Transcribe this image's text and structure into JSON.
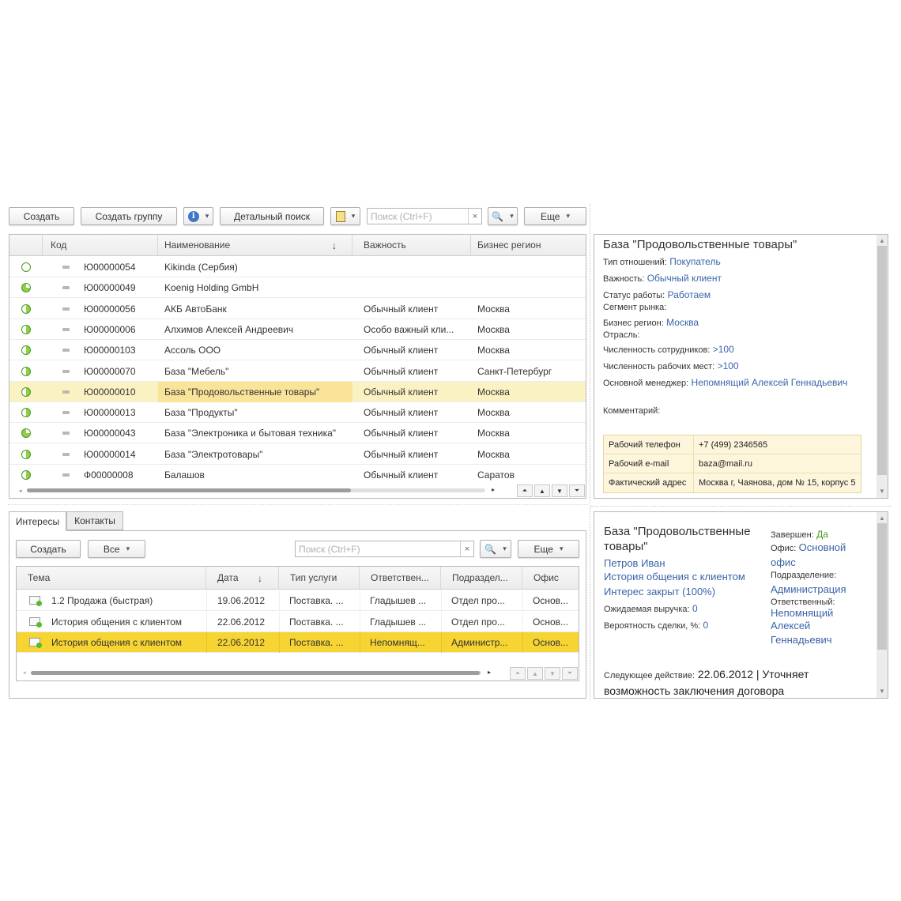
{
  "toolbar": {
    "create": "Создать",
    "create_group": "Создать группу",
    "detail_search": "Детальный поиск",
    "search_placeholder": "Поиск (Ctrl+F)",
    "more": "Еще"
  },
  "clients": {
    "columns": [
      "Код",
      "Наименование",
      "Важность",
      "Бизнес регион"
    ],
    "rows": [
      {
        "code": "Ю00000054",
        "name": "Kikinda (Сербия)",
        "importance": "",
        "region": "",
        "status": "empty"
      },
      {
        "code": "Ю00000049",
        "name": "Koenig Holding GmbH",
        "importance": "",
        "region": "",
        "status": "quarter"
      },
      {
        "code": "Ю00000056",
        "name": "АКБ АвтоБанк",
        "importance": "Обычный клиент",
        "region": "Москва",
        "status": "half"
      },
      {
        "code": "Ю00000006",
        "name": "Алхимов Алексей Андреевич",
        "importance": "Особо важный кли...",
        "region": "Москва",
        "status": "half"
      },
      {
        "code": "Ю00000103",
        "name": "Ассоль ООО",
        "importance": "Обычный клиент",
        "region": "Москва",
        "status": "half"
      },
      {
        "code": "Ю00000070",
        "name": "База \"Мебель\"",
        "importance": "Обычный клиент",
        "region": "Санкт-Петербург",
        "status": "half"
      },
      {
        "code": "Ю00000010",
        "name": "База \"Продовольственные товары\"",
        "importance": "Обычный клиент",
        "region": "Москва",
        "status": "half"
      },
      {
        "code": "Ю00000013",
        "name": "База \"Продукты\"",
        "importance": "Обычный клиент",
        "region": "Москва",
        "status": "half"
      },
      {
        "code": "Ю00000043",
        "name": "База \"Электроника и бытовая техника\"",
        "importance": "Обычный клиент",
        "region": "Москва",
        "status": "quarter"
      },
      {
        "code": "Ю00000014",
        "name": "База \"Электротовары\"",
        "importance": "Обычный клиент",
        "region": "Москва",
        "status": "half"
      },
      {
        "code": "Ф00000008",
        "name": "Балашов",
        "importance": "Обычный клиент",
        "region": "Саратов",
        "status": "half"
      }
    ]
  },
  "detail": {
    "title": "База \"Продовольственные товары\"",
    "relation_label": "Тип отношений:",
    "relation_value": "Покупатель",
    "importance_label": "Важность:",
    "importance_value": "Обычный клиент",
    "status_label": "Статус работы:",
    "status_value": "Работаем",
    "segment_label": "Сегмент рынка:",
    "region_label": "Бизнес регион:",
    "region_value": "Москва",
    "industry_label": "Отрасль:",
    "employees_label": "Численность сотрудников:",
    "employees_value": ">100",
    "workplaces_label": "Численность рабочих мест:",
    "workplaces_value": ">100",
    "manager_label": "Основной менеджер:",
    "manager_value": "Непомнящий Алексей Геннадьевич",
    "comment_label": "Комментарий:",
    "contacts": [
      {
        "label": "Рабочий телефон",
        "value": "+7 (499) 2346565"
      },
      {
        "label": "Рабочий e-mail",
        "value": "baza@mail.ru"
      },
      {
        "label": "Фактический адрес",
        "value": "Москва г, Чаянова, дом № 15, корпус 5"
      }
    ]
  },
  "tabs": [
    "Интересы",
    "Контакты"
  ],
  "interests": {
    "create": "Создать",
    "filter": "Все",
    "search_placeholder": "Поиск (Ctrl+F)",
    "more": "Еще",
    "columns": [
      "Тема",
      "Дата",
      "Тип услуги",
      "Ответствен...",
      "Подраздел...",
      "Офис"
    ],
    "rows": [
      {
        "topic": "1.2 Продажа (быстрая)",
        "date": "19.06.2012",
        "service": "Поставка. ...",
        "resp": "Гладышев ...",
        "dept": "Отдел про...",
        "office": "Основ..."
      },
      {
        "topic": "История общения с клиентом",
        "date": "22.06.2012",
        "service": "Поставка. ...",
        "resp": "Гладышев ...",
        "dept": "Отдел про...",
        "office": "Основ..."
      },
      {
        "topic": "История общения с клиентом",
        "date": "22.06.2012",
        "service": "Поставка. ...",
        "resp": "Непомнящ...",
        "dept": "Администр...",
        "office": "Основ..."
      }
    ]
  },
  "interest_detail": {
    "title_line1": "База \"Продовольственные",
    "title_line2": "товары\"",
    "person": "Петров Иван",
    "history": "История общения с клиентом",
    "closed": "Интерес закрыт (100%)",
    "revenue_label": "Ожидаемая выручка:",
    "revenue_value": "0",
    "probability_label": "Вероятность сделки, %:",
    "probability_value": "0",
    "finished_label": "Завершен:",
    "finished_value": "Да",
    "office_label": "Офис:",
    "office_value_1": "Основной",
    "office_value_2": "офис",
    "dept_label": "Подразделение:",
    "dept_value": "Администрация",
    "resp_label": "Ответственный:",
    "resp_value_1": "Непомнящий",
    "resp_value_2": "Алексей",
    "resp_value_3": "Геннадьевич",
    "next_label": "Следующее действие:",
    "next_value_1": "22.06.2012 | Уточняет",
    "next_value_2": "возможность заключения договора"
  }
}
